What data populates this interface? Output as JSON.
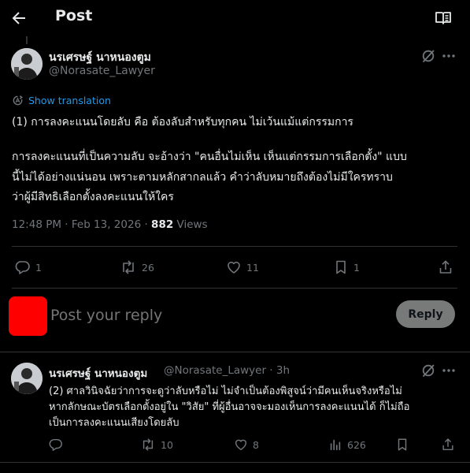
{
  "header": {
    "title": "Post"
  },
  "main_post": {
    "author_name": "นรเศรษฐ์ นาหนองตูม",
    "handle": "@Norasate_Lawyer",
    "translate_label": "Show translation",
    "text_lines": [
      "(1) การลงคะแนนโดยลับ คือ ต้องลับสำหรับทุกคน ไม่เว้นแม้แต่กรรมการ",
      "การลงคะแนนที่เป็นความลับ จะอ้างว่า \"คนอื่นไม่เห็น เห็นแต่กรรมการเลือกตั้ง\" แบบ",
      "นี้ไม่ได้อย่างแน่นอน เพราะตามหลักสากลแล้ว คำว่าลับหมายถึงต้องไม่มีใครทราบ",
      "ว่าผู้มีสิทธิเลือกตั้งลงคะแนนให้ใคร"
    ],
    "timestamp": "12:48 PM · Feb 13, 2026 · ",
    "views_count": "882",
    "views_label": " Views",
    "actions": {
      "replies": "1",
      "reposts": "26",
      "likes": "11",
      "bookmarks": "1"
    }
  },
  "composer": {
    "placeholder": "Post your reply",
    "button_label": "Reply",
    "avatar_color": "#ff0000"
  },
  "reply_post": {
    "author_name": "นรเศรษฐ์ นาหนองตูม",
    "handle_time": "@Norasate_Lawyer · 3h",
    "text_lines": [
      "(2) ศาลวินิจฉัยว่าการจะดูว่าลับหรือไม่  ไม่จำเป็นต้องพิสูจน์ว่ามีคนเห็นจริงหรือไม่",
      "หากลักษณะบัตรเลือกตั้งอยู่ใน \"วิสัย\" ที่ผู้อื่นอาจจะมองเห็นการลงคะแนนได้ ก็ไม่ถือ",
      "เป็นการลงคะแนนเสียงโดยลับ"
    ],
    "actions": {
      "reposts": "10",
      "likes": "8",
      "views": "626"
    }
  },
  "colors": {
    "background": "#000000",
    "text": "#e7e9ea",
    "muted": "#71767b",
    "link": "#1d9bf0",
    "divider": "#2f3336"
  }
}
